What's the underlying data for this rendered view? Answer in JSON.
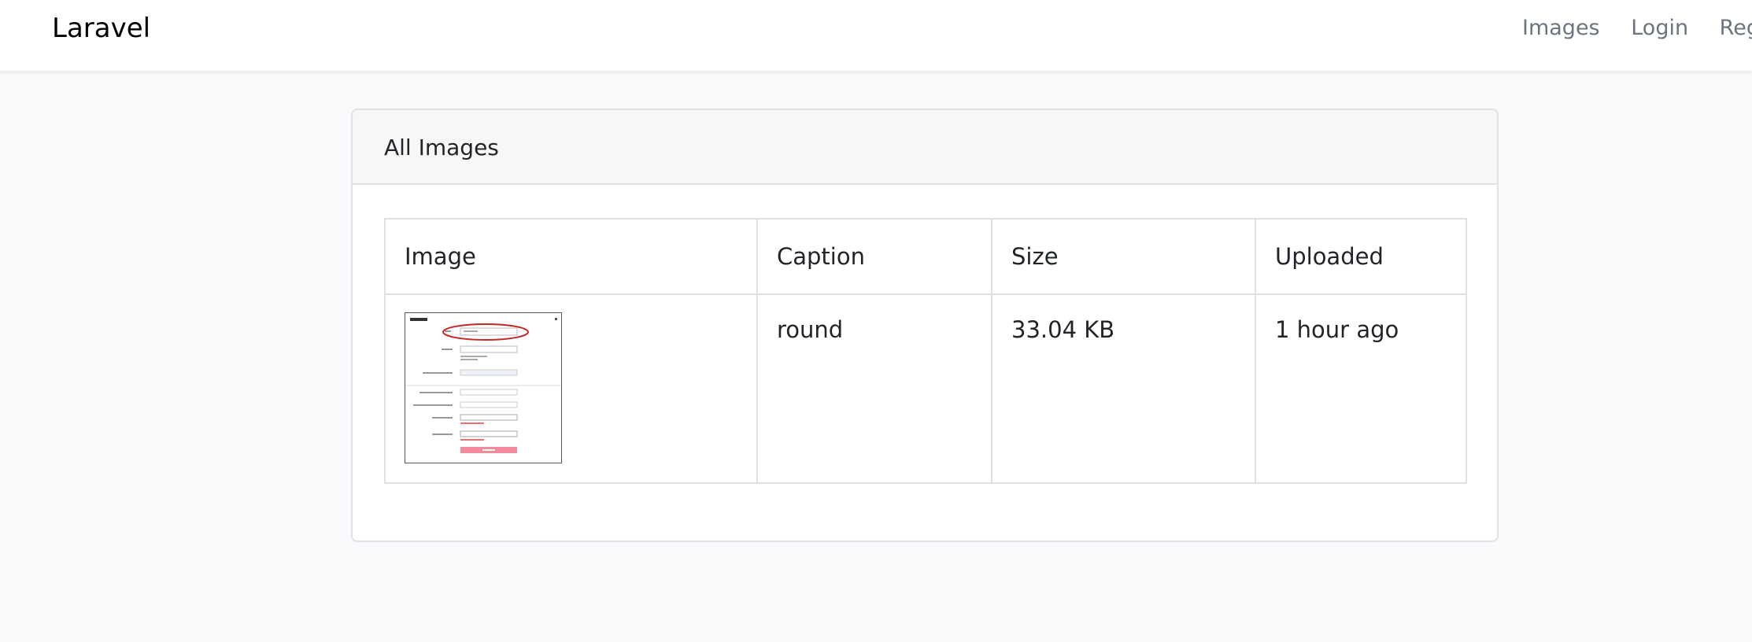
{
  "navbar": {
    "brand": "Laravel",
    "links": [
      "Images",
      "Login",
      "Register"
    ]
  },
  "card": {
    "header": "All Images"
  },
  "table": {
    "columns": [
      "Image",
      "Caption",
      "Size",
      "Uploaded"
    ],
    "rows": [
      {
        "image": "thumbnail",
        "caption": "round",
        "size": "33.04 KB",
        "uploaded": "1 hour ago"
      }
    ]
  },
  "colors": {
    "page_bg": "#f8fafc",
    "header_bg": "#f7f7f7",
    "thumb_highlight": "#c62828",
    "thumb_button": "#f28b9b"
  }
}
